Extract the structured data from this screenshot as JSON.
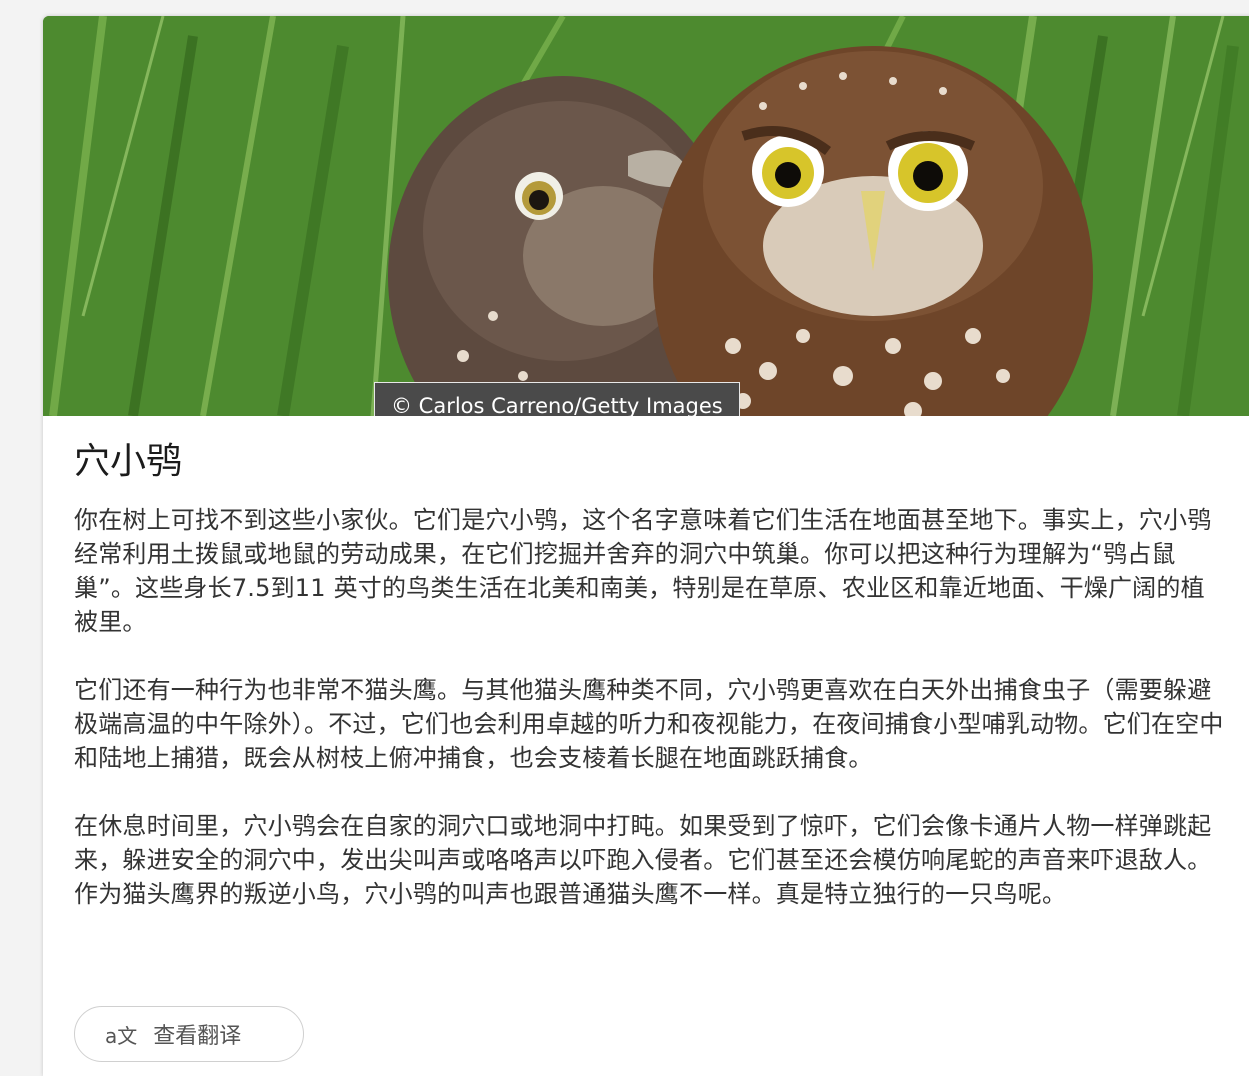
{
  "hero": {
    "image_description_icon": "owl-photo",
    "credit": "© Carlos Carreno/Getty Images"
  },
  "article": {
    "title": "穴小鸮",
    "paragraphs": [
      "你在树上可找不到这些小家伙。它们是穴小鸮，这个名字意味着它们生活在地面甚至地下。事实上，穴小鸮经常利用土拨鼠或地鼠的劳动成果，在它们挖掘并舍弃的洞穴中筑巢。你可以把这种行为理解为“鸮占鼠巢”。这些身长7.5到11 英寸的鸟类生活在北美和南美，特别是在草原、农业区和靠近地面、干燥广阔的植被里。",
      "它们还有一种行为也非常不猫头鹰。与其他猫头鹰种类不同，穴小鸮更喜欢在白天外出捕食虫子（需要躲避极端高温的中午除外）。不过，它们也会利用卓越的听力和夜视能力，在夜间捕食小型哺乳动物。它们在空中和陆地上捕猎，既会从树枝上俯冲捕食，也会支棱着长腿在地面跳跃捕食。",
      "在休息时间里，穴小鸮会在自家的洞穴口或地洞中打盹。如果受到了惊吓，它们会像卡通片人物一样弹跳起来，躲进安全的洞穴中，发出尖叫声或咯咯声以吓跑入侵者。它们甚至还会模仿响尾蛇的声音来吓退敌人。作为猫头鹰界的叛逆小鸟，穴小鸮的叫声也跟普通猫头鹰不一样。真是特立独行的一只鸟呢。"
    ]
  },
  "actions": {
    "translate_icon": "translate-icon",
    "translate_label": "查看翻译"
  }
}
